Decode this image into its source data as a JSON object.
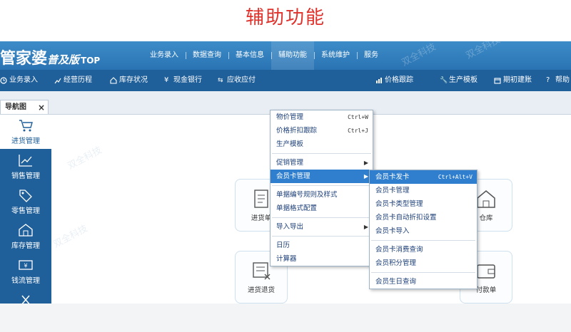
{
  "caption": "辅助功能",
  "app": {
    "logo_main": "管家婆",
    "logo_sub": "普及版",
    "logo_suffix": "TOP",
    "watermark": "双全科技"
  },
  "main_menu": [
    {
      "label": "业务录入"
    },
    {
      "label": "数据查询"
    },
    {
      "label": "基本信息"
    },
    {
      "label": "辅助功能"
    },
    {
      "label": "系统维护"
    },
    {
      "label": "服务"
    }
  ],
  "toolbar": [
    {
      "label": "业务录入",
      "icon": "clock-icon"
    },
    {
      "label": "经营历程",
      "icon": "chart-icon"
    },
    {
      "label": "库存状况",
      "icon": "house-icon"
    },
    {
      "label": "现金银行",
      "icon": "yen-icon"
    },
    {
      "label": "应收应付",
      "icon": "exchange-icon"
    },
    {
      "label": "价格跟踪",
      "icon": "chart-icon"
    },
    {
      "label": "生产模板",
      "icon": "wrench-icon"
    },
    {
      "label": "期初建账",
      "icon": "calendar-icon"
    },
    {
      "label": "帮助",
      "icon": "help-icon"
    }
  ],
  "tab": {
    "label": "导航图",
    "close": "×"
  },
  "sidebar": [
    {
      "label": "进货管理",
      "icon": "cart-icon"
    },
    {
      "label": "销售管理",
      "icon": "trend-icon"
    },
    {
      "label": "零售管理",
      "icon": "tag-icon"
    },
    {
      "label": "库存管理",
      "icon": "warehouse-icon"
    },
    {
      "label": "钱流管理",
      "icon": "banknote-icon"
    },
    {
      "label": "",
      "icon": "tools-icon"
    }
  ],
  "cards": [
    {
      "label": "进货单",
      "icon": "document-icon"
    },
    {
      "label": "仓库",
      "icon": "house-icon"
    },
    {
      "label": "进货退货",
      "icon": "document-cancel-icon"
    },
    {
      "label": "付款单",
      "icon": "wallet-icon"
    }
  ],
  "dropdown": {
    "items": [
      {
        "label": "物价管理",
        "shortcut": "Ctrl+W"
      },
      {
        "label": "价格折扣跟踪",
        "shortcut": "Ctrl+J"
      },
      {
        "label": "生产模板"
      },
      {
        "label": "促销管理",
        "has_submenu": true
      },
      {
        "label": "会员卡管理",
        "has_submenu": true
      },
      {
        "label": "单据编号规则及样式"
      },
      {
        "label": "单据格式配置"
      },
      {
        "label": "导入导出",
        "has_submenu": true
      },
      {
        "label": "日历"
      },
      {
        "label": "计算器"
      }
    ]
  },
  "submenu": {
    "items": [
      {
        "label": "会员卡发卡",
        "shortcut": "Ctrl+Alt+V"
      },
      {
        "label": "会员卡管理"
      },
      {
        "label": "会员卡类型管理"
      },
      {
        "label": "会员卡自动折扣设置"
      },
      {
        "label": "会员卡导入"
      },
      {
        "label": "会员卡消费查询"
      },
      {
        "label": "会员积分管理"
      },
      {
        "label": "会员生日查询"
      }
    ]
  },
  "colors": {
    "caption": "#e0312b",
    "topbar": "#2a73b3",
    "toolbar": "#1f5f9a",
    "highlight": "#2f7fce"
  }
}
